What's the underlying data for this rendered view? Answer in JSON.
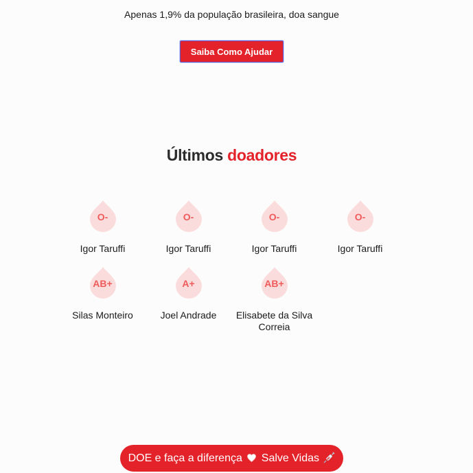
{
  "hero": {
    "tagline": "Apenas 1,9% da população brasileira, doa sangue",
    "cta_label": "Saiba Como Ajudar"
  },
  "donors_section": {
    "title_part1": "Últimos",
    "title_part2": "doadores",
    "donors": [
      {
        "blood_type": "O-",
        "name": "Igor Taruffi"
      },
      {
        "blood_type": "O-",
        "name": "Igor Taruffi"
      },
      {
        "blood_type": "O-",
        "name": "Igor Taruffi"
      },
      {
        "blood_type": "O-",
        "name": "Igor Taruffi"
      },
      {
        "blood_type": "AB+",
        "name": "Silas Monteiro"
      },
      {
        "blood_type": "A+",
        "name": "Joel Andrade"
      },
      {
        "blood_type": "AB+",
        "name": "Elisabete da Silva Correia"
      }
    ]
  },
  "footer": {
    "text_before": "DOE e faça a diferença",
    "text_after": "Salve Vidas",
    "icons": [
      "heart-icon",
      "syringe-icon"
    ]
  },
  "colors": {
    "accent": "#e3222a",
    "drop_fill": "#fbdcdc",
    "drop_text": "#ef5a5a",
    "background": "#fcfcfc"
  }
}
